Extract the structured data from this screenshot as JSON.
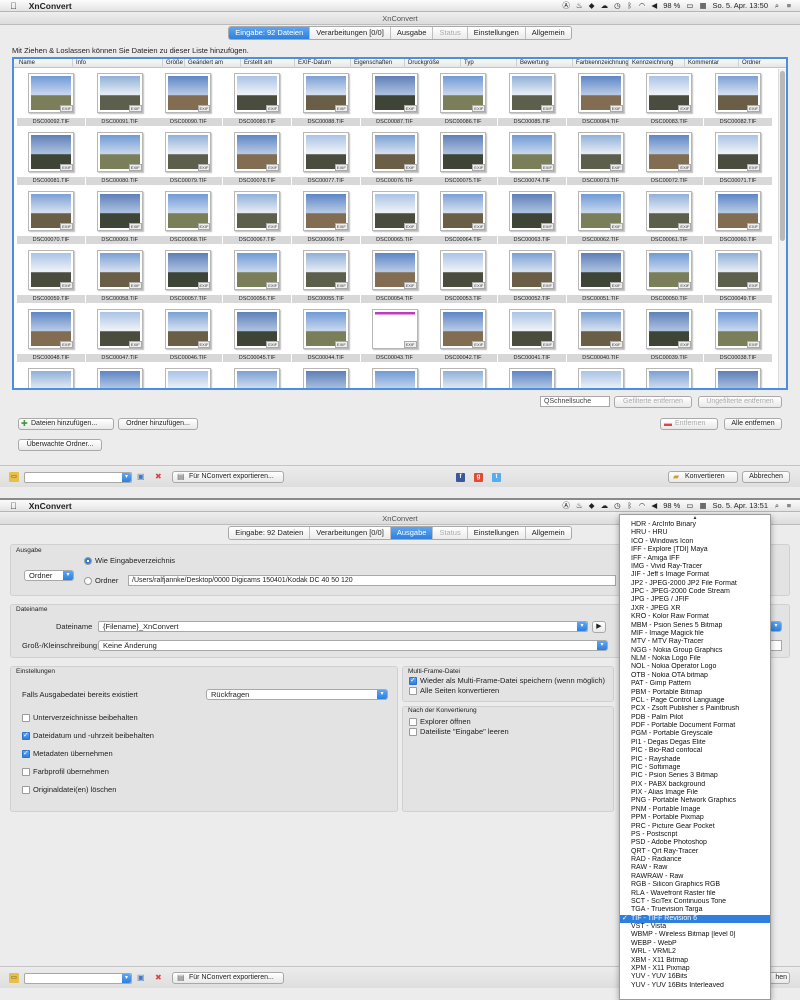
{
  "screen1": {
    "menubar": {
      "app": "XnConvert",
      "battery": "98 %",
      "datetime": "So. 5. Apr.  13:50"
    },
    "window_title": "XnConvert",
    "tabs": [
      {
        "label": "Eingabe: 92 Dateien",
        "state": "active"
      },
      {
        "label": "Verarbeitungen [0/0]",
        "state": "normal"
      },
      {
        "label": "Ausgabe",
        "state": "normal"
      },
      {
        "label": "Status",
        "state": "disabled"
      },
      {
        "label": "Einstellungen",
        "state": "normal"
      },
      {
        "label": "Allgemein",
        "state": "normal"
      }
    ],
    "hint": "Mit Ziehen & Loslassen können Sie Dateien zu dieser Liste hinzufügen.",
    "columns": [
      "Name",
      "Info",
      "Größe",
      "Geändert am",
      "Erstellt am",
      "EXIF-Datum",
      "Eigenschaften",
      "Druckgröße",
      "Typ",
      "Bewertung",
      "Farbkennzeichnung",
      "Kennzeichnung",
      "Kommentar",
      "Ordner"
    ],
    "exif_badge": "EXIF",
    "files": [
      "DSC00092.TIF",
      "DSC00091.TIF",
      "DSC00090.TIF",
      "DSC00089.TIF",
      "DSC00088.TIF",
      "DSC00087.TIF",
      "DSC00086.TIF",
      "DSC00085.TIF",
      "DSC00084.TIF",
      "DSC00083.TIF",
      "DSC00082.TIF",
      "DSC00081.TIF",
      "DSC00080.TIF",
      "DSC00079.TIF",
      "DSC00078.TIF",
      "DSC00077.TIF",
      "DSC00076.TIF",
      "DSC00075.TIF",
      "DSC00074.TIF",
      "DSC00073.TIF",
      "DSC00072.TIF",
      "DSC00071.TIF",
      "DSC00070.TIF",
      "DSC00069.TIF",
      "DSC00068.TIF",
      "DSC00067.TIF",
      "DSC00066.TIF",
      "DSC00065.TIF",
      "DSC00064.TIF",
      "DSC00063.TIF",
      "DSC00062.TIF",
      "DSC00061.TIF",
      "DSC00060.TIF",
      "DSC00059.TIF",
      "DSC00058.TIF",
      "DSC00057.TIF",
      "DSC00056.TIF",
      "DSC00055.TIF",
      "DSC00054.TIF",
      "DSC00053.TIF",
      "DSC00052.TIF",
      "DSC00051.TIF",
      "DSC00050.TIF",
      "DSC00049.TIF",
      "DSC00048.TIF",
      "DSC00047.TIF",
      "DSC00046.TIF",
      "DSC00045.TIF",
      "DSC00044.TIF",
      "DSC00043.TIF",
      "DSC00042.TIF",
      "DSC00041.TIF",
      "DSC00040.TIF",
      "DSC00039.TIF",
      "DSC00038.TIF",
      "",
      "",
      "",
      "",
      "",
      "",
      "",
      "",
      "",
      "",
      ""
    ],
    "quicksearch_placeholder": "QSchnellsuche",
    "buttons": {
      "filtered_remove": "Gefilterte entfernen",
      "unfiltered_remove": "Ungefilterte entfernen",
      "add_files": "Dateien hinzufügen...",
      "add_folder": "Ordner hinzufügen...",
      "remove": "Entfernen",
      "remove_all": "Alle entfernen",
      "watched_folder": "Überwachte Ordner...",
      "export_nconvert": "Für NConvert exportieren...",
      "convert": "Konvertieren",
      "cancel": "Abbrechen"
    }
  },
  "screen2": {
    "menubar": {
      "app": "XnConvert",
      "battery": "98 %",
      "datetime": "So. 5. Apr.  13:51"
    },
    "window_title": "XnConvert",
    "tabs": [
      {
        "label": "Eingabe: 92 Dateien",
        "state": "normal"
      },
      {
        "label": "Verarbeitungen [0/0]",
        "state": "normal"
      },
      {
        "label": "Ausgabe",
        "state": "active"
      },
      {
        "label": "Status",
        "state": "disabled"
      },
      {
        "label": "Einstellungen",
        "state": "normal"
      },
      {
        "label": "Allgemein",
        "state": "normal"
      }
    ],
    "ausgabe": {
      "group_label": "Ausgabe",
      "mode_select": "Ordner",
      "radio_same": "Wie Eingabeverzeichnis",
      "radio_folder": "Ordner",
      "folder_path": "/Users/ralfjannke/Desktop/0000 Digicams 150401/Kodak DC 40 50 120"
    },
    "dateiname": {
      "group_label": "Dateiname",
      "name_label": "Dateiname",
      "name_value": "{Filename}_XnConvert",
      "case_label": "Groß-/Kleinschreibung",
      "case_value": "Keine Änderung"
    },
    "einstellungen": {
      "group_label": "Einstellungen",
      "exists_label": "Falls Ausgabedatei bereits existiert",
      "exists_value": "Rückfragen",
      "checks": [
        {
          "label": "Unterverzeichnisse beibehalten",
          "checked": false
        },
        {
          "label": "Dateidatum und -uhrzeit beibehalten",
          "checked": true
        },
        {
          "label": "Metadaten übernehmen",
          "checked": true
        },
        {
          "label": "Farbprofil übernehmen",
          "checked": false
        },
        {
          "label": "Originaldatei(en) löschen",
          "checked": false
        }
      ]
    },
    "multiframe": {
      "group_label": "Multi-Frame-Datei",
      "checks": [
        {
          "label": "Wieder als Multi-Frame-Datei speichern (wenn möglich)",
          "checked": true
        },
        {
          "label": "Alle Seiten konvertieren",
          "checked": false
        }
      ]
    },
    "after": {
      "group_label": "Nach der Konvertierung",
      "checks": [
        {
          "label": "Explorer öffnen",
          "checked": false
        },
        {
          "label": "Dateiliste \"Eingabe\" leeren",
          "checked": false
        }
      ]
    },
    "format_list": [
      "HDR - ArcInfo Binary",
      "HRU - HRU",
      "ICO - Windows Icon",
      "IFF - Explore [TDI]   Maya",
      "IFF - Amiga IFF",
      "IMG - Vivid Ray-Tracer",
      "JIF - Jeff s Image Format",
      "JP2 - JPEG-2000 JP2 File Format",
      "JPC - JPEG-2000 Code Stream",
      "JPG - JPEG / JFIF",
      "JXR - JPEG XR",
      "KRO - Kolor Raw Format",
      "MBM - Psion Series 5 Bitmap",
      "MIF - Image Magick file",
      "MTV - MTV Ray-Tracer",
      "NGG - Nokia Group Graphics",
      "NLM - Nokia Logo File",
      "NOL - Nokia Operator Logo",
      "OTB - Nokia OTA bitmap",
      "PAT - Gimp Pattern",
      "PBM - Portable Bitmap",
      "PCL - Page Control Language",
      "PCX - Zsoft Publisher s Paintbrush",
      "PDB - Palm Pilot",
      "PDF - Portable Document Format",
      "PGM - Portable Greyscale",
      "PI1 - Degas   Degas Elite",
      "PIC - Bio-Rad confocal",
      "PIC - Rayshade",
      "PIC - Softimage",
      "PIC - Psion Series 3 Bitmap",
      "PIX - PABX background",
      "PIX - Alias Image File",
      "PNG - Portable Network Graphics",
      "PNM - Portable Image",
      "PPM - Portable Pixmap",
      "PRC - Picture Gear Pocket",
      "PS - Postscript",
      "PSD - Adobe Photoshop",
      "QRT - Qrt Ray-Tracer",
      "RAD - Radiance",
      "RAW - Raw",
      "RAWRAW - Raw",
      "RGB - Silicon Graphics RGB",
      "RLA - Wavefront Raster file",
      "SCT - SciTex Continuous Tone",
      "TGA - Truevision Targa",
      "TIF - TIFF Revision 6",
      "VST - Vista",
      "WBMP - Wireless Bitmap [level 0]",
      "WEBP - WebP",
      "WRL - VRML2",
      "XBM - X11 Bitmap",
      "XPM - X11 Pixmap",
      "YUV - YUV 16Bits",
      "YUV - YUV 16Bits Interleaved"
    ],
    "format_selected": "TIF - TIFF Revision 6",
    "buttons": {
      "export_nconvert": "Für NConvert exportieren...",
      "cancel_partial": "hen"
    }
  },
  "colors": {
    "accent": "#2f7fdc",
    "selection_border": "#4a90e2"
  }
}
